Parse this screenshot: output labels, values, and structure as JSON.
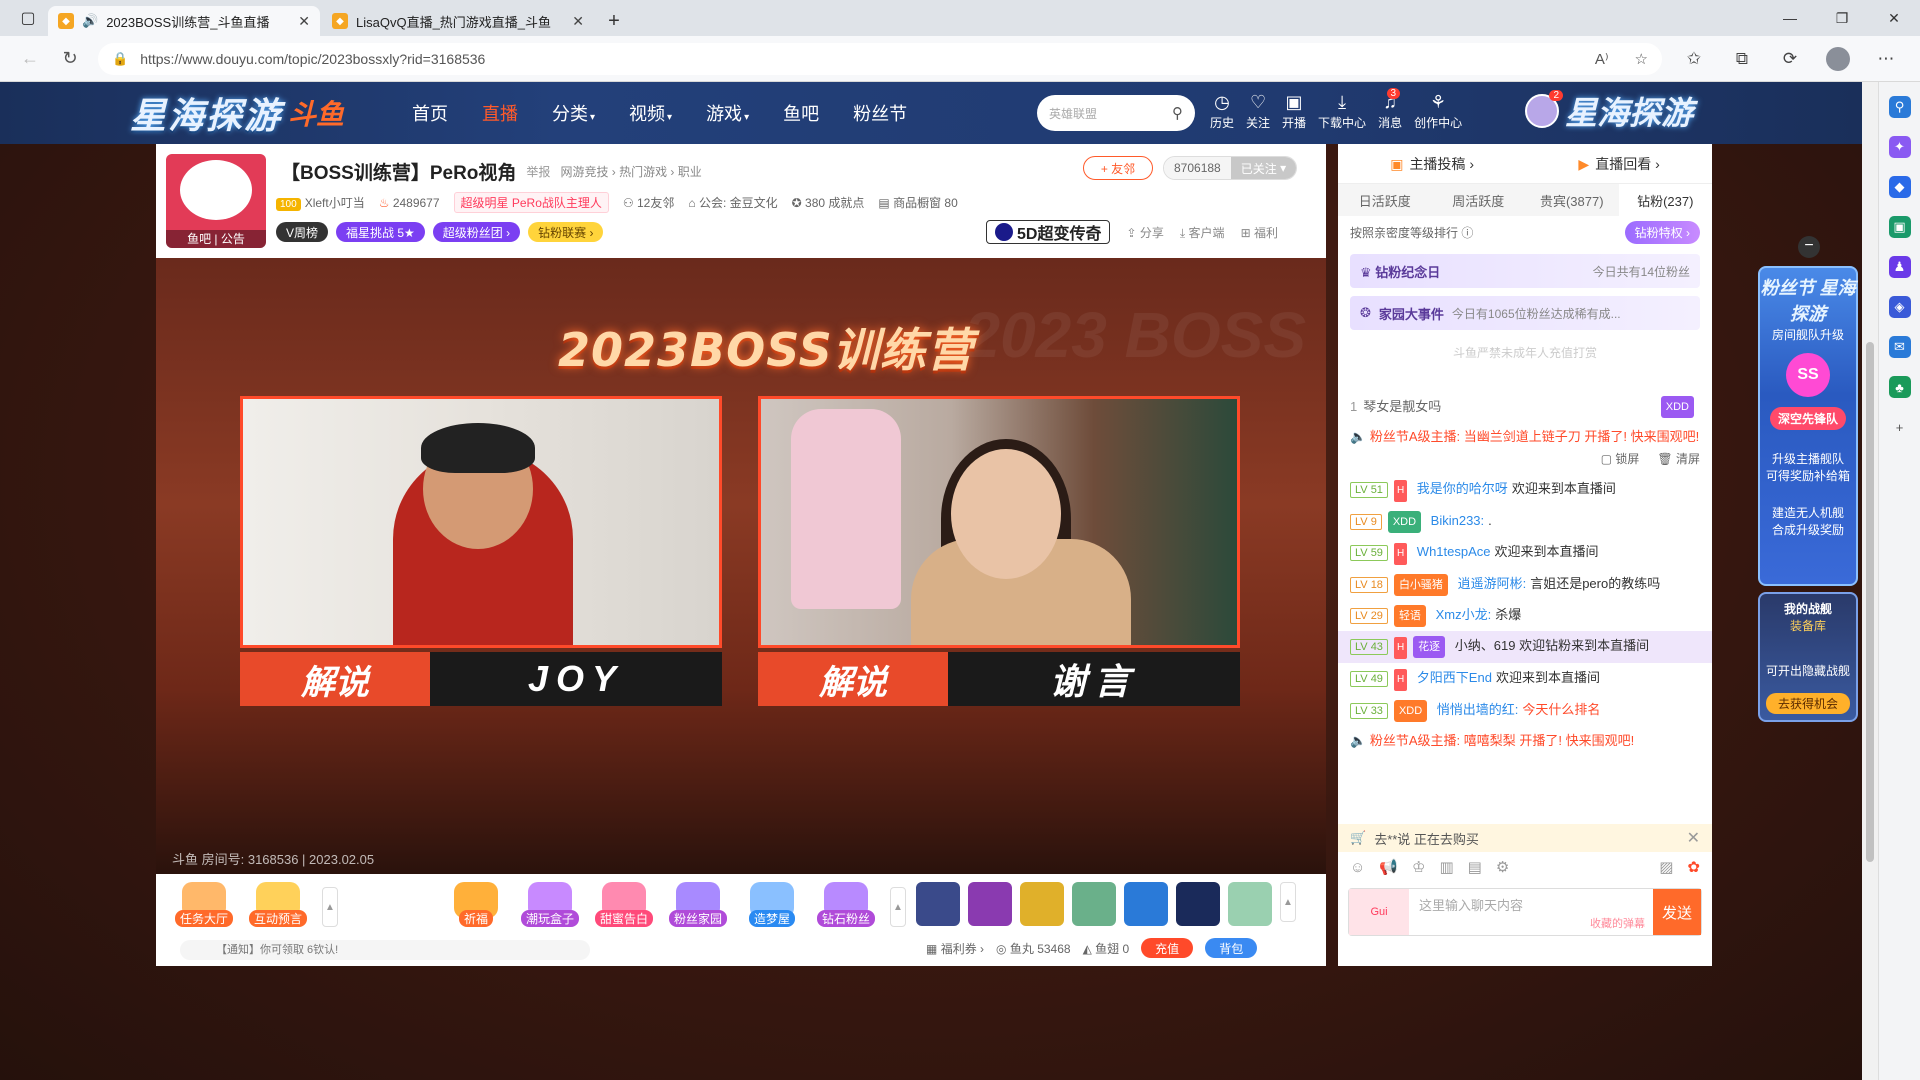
{
  "browser": {
    "tabs": [
      {
        "title": "2023BOSS训练营_斗鱼直播",
        "active": true,
        "audio": true
      },
      {
        "title": "LisaQvQ直播_热门游戏直播_斗鱼",
        "active": false,
        "audio": false
      }
    ],
    "url": "https://www.douyu.com/topic/2023bossxly?rid=3168536"
  },
  "header": {
    "event_logo": "星海探游",
    "site_logo": "斗鱼",
    "nav": [
      {
        "label": "首页",
        "active": false,
        "dropdown": false
      },
      {
        "label": "直播",
        "active": true,
        "dropdown": false
      },
      {
        "label": "分类",
        "active": false,
        "dropdown": true
      },
      {
        "label": "视频",
        "active": false,
        "dropdown": true
      },
      {
        "label": "游戏",
        "active": false,
        "dropdown": true
      },
      {
        "label": "鱼吧",
        "active": false,
        "dropdown": false
      },
      {
        "label": "粉丝节",
        "active": false,
        "dropdown": false
      }
    ],
    "search_placeholder": "英雄联盟",
    "icons": [
      {
        "label": "历史",
        "glyph": "◷",
        "badge": ""
      },
      {
        "label": "关注",
        "glyph": "♡",
        "badge": ""
      },
      {
        "label": "开播",
        "glyph": "▣",
        "badge": ""
      },
      {
        "label": "下载中心",
        "glyph": "⤓",
        "badge": ""
      },
      {
        "label": "消息",
        "glyph": "🔔",
        "badge": "3"
      },
      {
        "label": "创作中心",
        "glyph": "⚲",
        "badge": ""
      }
    ],
    "avatar_badge": "2",
    "right_logo": "星海探游"
  },
  "room": {
    "avatar_label": "鱼吧 | 公告",
    "title": "【BOSS训练营】PeRo视角",
    "report": "举报",
    "breadcrumb": "网游竞技 › 热门游戏 › 职业",
    "level": "100",
    "streamer": "Xleft小叮当",
    "hot": "2489677",
    "v_tag": "超级明星 PeRo战队主理人",
    "friends": "12友邻",
    "guild": "公会: 金豆文化",
    "achievements": "380 成就点",
    "shop": "商品橱窗 80",
    "tags": [
      "V周榜",
      "福星挑战 5★",
      "超级粉丝团 ›",
      "钻粉联赛 ›"
    ],
    "friend_btn": "+ 友邻",
    "follow_count": "8706188",
    "follow_btn": "已关注",
    "promo": "5D超变传奇",
    "actions": [
      "分享",
      "客户端",
      "福利"
    ]
  },
  "video": {
    "title": "2023BOSS训练营",
    "bg_text": "2023 BOSS",
    "cams": [
      {
        "role": "解说",
        "name": "JOY"
      },
      {
        "role": "解说",
        "name": "谢言"
      }
    ],
    "stamp": "斗鱼 房间号: 3168536 | 2023.02.05"
  },
  "player_bar": {
    "gifts_left": [
      "任务大厅",
      "互动预言"
    ],
    "gifts_mid": [
      "祈福",
      "潮玩盒子",
      "甜蜜告白",
      "粉丝家园",
      "造梦屋",
      "钻石粉丝"
    ],
    "notice": "【通知】你可领取 6钦认!",
    "wallet": {
      "welfare": "福利券 ›",
      "fish_balls": "鱼丸 53468",
      "fish_fins": "鱼翅 0",
      "recharge": "充值",
      "backpack": "背包"
    }
  },
  "chat": {
    "top": [
      "主播投稿 ›",
      "直播回看 ›"
    ],
    "rank_tabs": [
      "日活跃度",
      "周活跃度",
      "贵宾(3877)",
      "钻粉(237)"
    ],
    "rank_hint": "按照亲密度等级排行",
    "privilege_btn": "钻粉特权 ›",
    "banner1_title": "钻粉纪念日",
    "banner1_info": "今日共有14位粉丝",
    "banner2_title": "家园大事件",
    "banner2_info": "今日有1065位粉丝达成稀有成...",
    "warn": "斗鱼严禁未成年人充值打赏",
    "lock_btn": "锁屏",
    "clear_btn": "清屏",
    "messages": [
      {
        "lv": "",
        "badge": "",
        "nick": "琴女是靓女吗",
        "text": "",
        "type": "top"
      },
      {
        "lv": "",
        "badge": "",
        "nick": "粉丝节A级主播:",
        "text": "当幽兰剑道上链子刀 开播了! 快来围观吧!",
        "type": "system"
      },
      {
        "lv": "LV 51",
        "badge": "",
        "nick": "我是你的哈尔呀",
        "text": "欢迎来到本直播间",
        "type": "welcome"
      },
      {
        "lv": "LV 9",
        "badge": "XDD",
        "nick": "Bikin233:",
        "text": ".",
        "type": "chat"
      },
      {
        "lv": "LV 59",
        "badge": "",
        "nick": "Wh1tespAce",
        "text": "欢迎来到本直播间",
        "type": "welcome"
      },
      {
        "lv": "LV 18",
        "badge": "白小骚猪",
        "nick": "逍遥游阿彬:",
        "text": "言姐还是pero的教练吗",
        "type": "chat"
      },
      {
        "lv": "LV 29",
        "badge": "轻语",
        "nick": "Xmz小龙:",
        "text": "杀爆",
        "type": "chat"
      },
      {
        "lv": "LV 43",
        "badge": "花逐",
        "nick": "小纳、619",
        "text": "欢迎钻粉来到本直播间",
        "type": "vip"
      },
      {
        "lv": "LV 49",
        "badge": "",
        "nick": "夕阳西下End",
        "text": "欢迎来到本直播间",
        "type": "welcome"
      },
      {
        "lv": "LV 33",
        "badge": "XDD",
        "nick": "悄悄出墙的红:",
        "text": "今天什么排名",
        "type": "chat"
      },
      {
        "lv": "",
        "badge": "",
        "nick": "粉丝节A级主播:",
        "text": "嘻嘻梨梨 开播了! 快来围观吧!",
        "type": "system"
      }
    ],
    "buying": "去**说 正在去购买",
    "input_placeholder": "这里输入聊天内容",
    "input_hint": "收藏的弹幕",
    "send": "发送",
    "gui_label": "Gui"
  },
  "float_ad": {
    "title": "粉丝节 星海探游",
    "sub": "房间舰队升级",
    "ss": "SS",
    "btn1": "深空先锋队",
    "line1": "升级主播舰队 可得奖励补给箱",
    "line2": "建造无人机舰 合成升级奖励",
    "card2_title": "我的战舰",
    "card2_sub": "装备库",
    "card2_line": "可开出隐藏战舰",
    "card2_btn": "去获得机会"
  }
}
